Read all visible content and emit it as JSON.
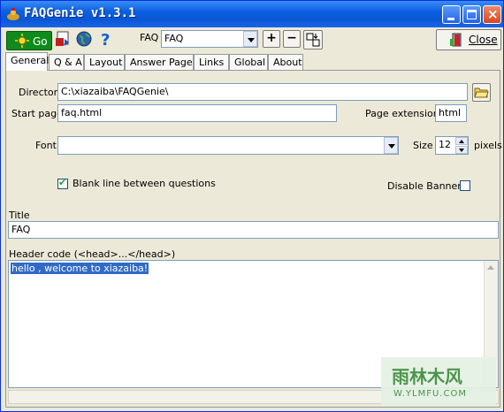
{
  "window": {
    "title": "FAQGenie v1.3.1"
  },
  "toolbar": {
    "go_label": "Go",
    "faq_label": "FAQ",
    "faq_value": "FAQ",
    "add_symbol": "+",
    "remove_symbol": "−",
    "close_label": "Close"
  },
  "tabs": [
    "General",
    "Q & A",
    "Layout",
    "Answer Page",
    "Links",
    "Global",
    "About"
  ],
  "general": {
    "directory_label": "Directory",
    "directory_value": "C:\\xiazaiba\\FAQGenie\\",
    "start_page_label": "Start page",
    "start_page_value": "faq.html",
    "page_ext_label": "Page extension",
    "page_ext_value": "html",
    "font_label": "Font",
    "font_value": "",
    "size_label": "Size",
    "size_value": "12",
    "pixels_label": "pixels",
    "blank_line_label": "Blank line between questions",
    "blank_line_checked": true,
    "disable_banner_label": "Disable Banner",
    "disable_banner_checked": false,
    "title_label": "Title",
    "title_value": "FAQ",
    "header_code_label": "Header code (<head>...</head>)",
    "header_code_value": "hello , welcome to xiazaiba!"
  },
  "watermark": {
    "line1": "雨林木风",
    "line2": "W.YLMFU.COM"
  },
  "colors": {
    "titlebar": "#0a5fe0",
    "go_button": "#0f8a1d",
    "selection": "#316ac5"
  }
}
